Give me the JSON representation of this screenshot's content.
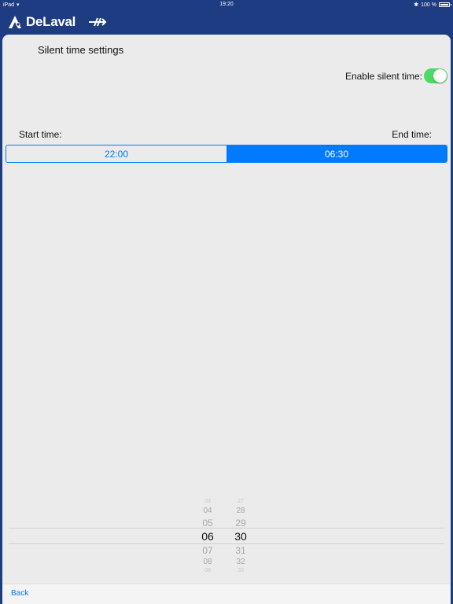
{
  "status_bar": {
    "device": "iPad",
    "time": "19:20",
    "battery": "100 %"
  },
  "header": {
    "brand": "DeLaval",
    "logo_icon": "delaval-logo-icon",
    "sync_icon": "sync-arrows-icon"
  },
  "page": {
    "title": "Silent time settings"
  },
  "enable": {
    "label": "Enable silent time:",
    "on": true
  },
  "times": {
    "start_label": "Start time:",
    "end_label": "End time:",
    "start_value": "22:00",
    "end_value": "06:30",
    "selected": "end"
  },
  "picker": {
    "hours": [
      "03",
      "04",
      "05",
      "06",
      "07",
      "08",
      "09"
    ],
    "minutes": [
      "27",
      "28",
      "29",
      "30",
      "31",
      "32",
      "33"
    ],
    "selected_hour": "06",
    "selected_minute": "30"
  },
  "footer": {
    "back_label": "Back"
  },
  "colors": {
    "header_bg": "#1e3c82",
    "accent": "#007aff",
    "toggle_on": "#4cd964",
    "content_bg": "#ebebeb"
  }
}
